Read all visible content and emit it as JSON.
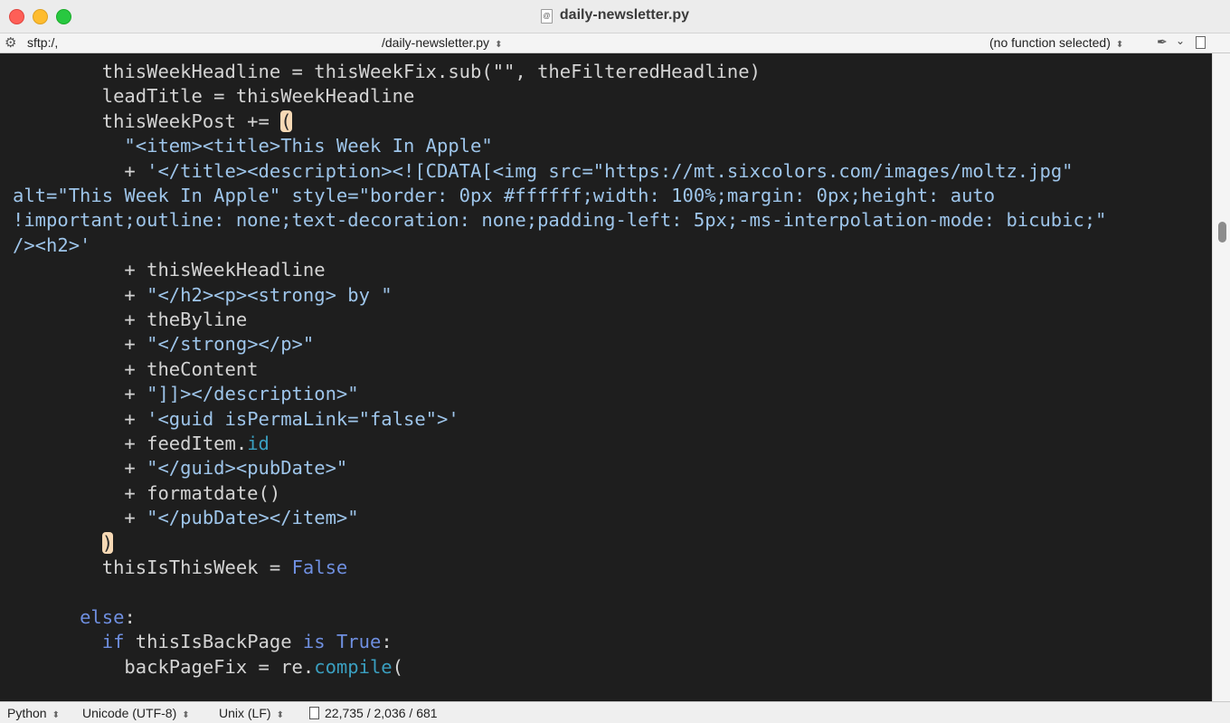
{
  "window": {
    "title": "daily-newsletter.py",
    "doc_badge": "@"
  },
  "navbar": {
    "path": "sftp:/,",
    "file": "/daily-newsletter.py",
    "function_menu": "(no function selected)",
    "updown_glyph": "⌃⌄"
  },
  "icons": {
    "gear": "gear-icon",
    "pin": "pin-icon",
    "chevron": "chevron-down-icon",
    "document": "document-icon"
  },
  "colors": {
    "background": "#1e1e1e",
    "plain_text": "#d4d4d4",
    "string": "#9ec5ea",
    "keyword": "#6f8fe0",
    "attribute": "#3a9fc0",
    "bracket_highlight": "#f7d9b5"
  },
  "code": {
    "lines": [
      [
        {
          "t": "p",
          "v": "        thisWeekHeadline = thisWeekFix.sub(\"\", theFilteredHeadline)"
        }
      ],
      [
        {
          "t": "p",
          "v": "        leadTitle = thisWeekHeadline"
        }
      ],
      [
        {
          "t": "p",
          "v": "        thisWeekPost += "
        },
        {
          "t": "paren",
          "v": "("
        }
      ],
      [
        {
          "t": "p",
          "v": "          "
        },
        {
          "t": "s",
          "v": "\"<item><title>This Week In Apple\""
        }
      ],
      [
        {
          "t": "p",
          "v": "          + "
        },
        {
          "t": "s",
          "v": "'</title><description><![CDATA[<img src=\"https://mt.sixcolors.com/images/moltz.jpg\""
        }
      ],
      [
        {
          "t": "s",
          "v": "alt=\"This Week In Apple\" style=\"border: 0px #ffffff;width: 100%;margin: 0px;height: auto"
        }
      ],
      [
        {
          "t": "s",
          "v": "!important;outline: none;text-decoration: none;padding-left: 5px;-ms-interpolation-mode: bicubic;\""
        }
      ],
      [
        {
          "t": "s",
          "v": "/><h2>'"
        }
      ],
      [
        {
          "t": "p",
          "v": "          + thisWeekHeadline"
        }
      ],
      [
        {
          "t": "p",
          "v": "          + "
        },
        {
          "t": "s",
          "v": "\"</h2><p><strong> by \""
        }
      ],
      [
        {
          "t": "p",
          "v": "          + theByline"
        }
      ],
      [
        {
          "t": "p",
          "v": "          + "
        },
        {
          "t": "s",
          "v": "\"</strong></p>\""
        }
      ],
      [
        {
          "t": "p",
          "v": "          + theContent"
        }
      ],
      [
        {
          "t": "p",
          "v": "          + "
        },
        {
          "t": "s",
          "v": "\"]]></description>\""
        }
      ],
      [
        {
          "t": "p",
          "v": "          + "
        },
        {
          "t": "s",
          "v": "'<guid isPermaLink=\"false\">'"
        }
      ],
      [
        {
          "t": "p",
          "v": "          + feedItem."
        },
        {
          "t": "a",
          "v": "id"
        }
      ],
      [
        {
          "t": "p",
          "v": "          + "
        },
        {
          "t": "s",
          "v": "\"</guid><pubDate>\""
        }
      ],
      [
        {
          "t": "p",
          "v": "          + formatdate()"
        }
      ],
      [
        {
          "t": "p",
          "v": "          + "
        },
        {
          "t": "s",
          "v": "\"</pubDate></item>\""
        }
      ],
      [
        {
          "t": "p",
          "v": "        "
        },
        {
          "t": "paren",
          "v": ")"
        }
      ],
      [
        {
          "t": "p",
          "v": "        thisIsThisWeek = "
        },
        {
          "t": "k",
          "v": "False"
        }
      ],
      [
        {
          "t": "p",
          "v": ""
        }
      ],
      [
        {
          "t": "p",
          "v": "      "
        },
        {
          "t": "k",
          "v": "else"
        },
        {
          "t": "p",
          "v": ":"
        }
      ],
      [
        {
          "t": "p",
          "v": "        "
        },
        {
          "t": "k",
          "v": "if"
        },
        {
          "t": "p",
          "v": " thisIsBackPage "
        },
        {
          "t": "k",
          "v": "is"
        },
        {
          "t": "p",
          "v": " "
        },
        {
          "t": "k",
          "v": "True"
        },
        {
          "t": "p",
          "v": ":"
        }
      ],
      [
        {
          "t": "p",
          "v": "          backPageFix = re."
        },
        {
          "t": "a",
          "v": "compile"
        },
        {
          "t": "p",
          "v": "("
        }
      ]
    ]
  },
  "statusbar": {
    "language": "Python",
    "encoding": "Unicode (UTF-8)",
    "line_endings": "Unix (LF)",
    "stats": "22,735 / 2,036 / 681"
  }
}
